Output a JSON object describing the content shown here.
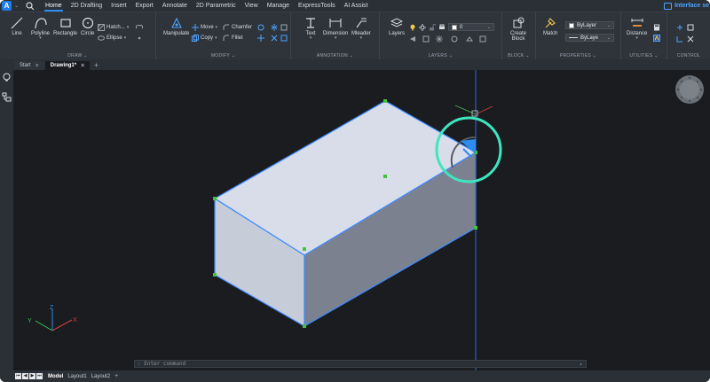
{
  "app": {
    "logo_letter": "A",
    "interface_label": "Interface se"
  },
  "menu": {
    "items": [
      {
        "label": "Home",
        "active": true
      },
      {
        "label": "2D Drafting",
        "active": false
      },
      {
        "label": "Insert",
        "active": false
      },
      {
        "label": "Export",
        "active": false
      },
      {
        "label": "Annotate",
        "active": false
      },
      {
        "label": "2D Parametric",
        "active": false
      },
      {
        "label": "View",
        "active": false
      },
      {
        "label": "Manage",
        "active": false
      },
      {
        "label": "ExpressTools",
        "active": false
      },
      {
        "label": "AI Assist",
        "active": false
      }
    ]
  },
  "ribbon": {
    "draw": {
      "title": "DRAW",
      "line": "Line",
      "polyline": "Polyline",
      "rectangle": "Rectangle",
      "circle": "Circle",
      "hatch": "Hatch...",
      "ellipse": "Ellipse"
    },
    "modify": {
      "title": "MODIFY",
      "manipulate": "Manipulate",
      "move": "Move",
      "copy": "Copy",
      "chamfer": "Chamfer",
      "fillet": "Fillet"
    },
    "annotation": {
      "title": "ANNOTATION",
      "text": "Text",
      "dimension": "Dimension",
      "mleader": "Mleader"
    },
    "layers": {
      "title": "LAYERS",
      "layers": "Layers",
      "current_layer": "0"
    },
    "block": {
      "title": "BLOCK",
      "create_block_line1": "Create",
      "create_block_line2": "Block"
    },
    "properties": {
      "title": "PROPERTIES",
      "match": "Match",
      "color_value": "ByLayer",
      "linetype_value": "ByLaye"
    },
    "utilities": {
      "title": "UTILITIES",
      "distance": "Distance"
    },
    "control": {
      "title": "CONTROL"
    }
  },
  "tabs": {
    "items": [
      {
        "label": "Start",
        "active": false,
        "closable": true
      },
      {
        "label": "Drawing1*",
        "active": true,
        "closable": true
      }
    ],
    "add_symbol": "+"
  },
  "command": {
    "placeholder": ": Enter command"
  },
  "axes": {
    "x": "X",
    "y": "Y",
    "z": "Z"
  },
  "layouts": {
    "items": [
      {
        "label": "Model",
        "active": true
      },
      {
        "label": "Layout1",
        "active": false
      },
      {
        "label": "Layout2",
        "active": false
      }
    ],
    "add_symbol": "+"
  },
  "colors": {
    "accent": "#2d8cf0",
    "highlight_ring": "#3ee6c0",
    "grip": "#44c23a",
    "box_top": "#d8dde9",
    "box_left": "#c7ccd9",
    "box_right": "#7c8190"
  }
}
